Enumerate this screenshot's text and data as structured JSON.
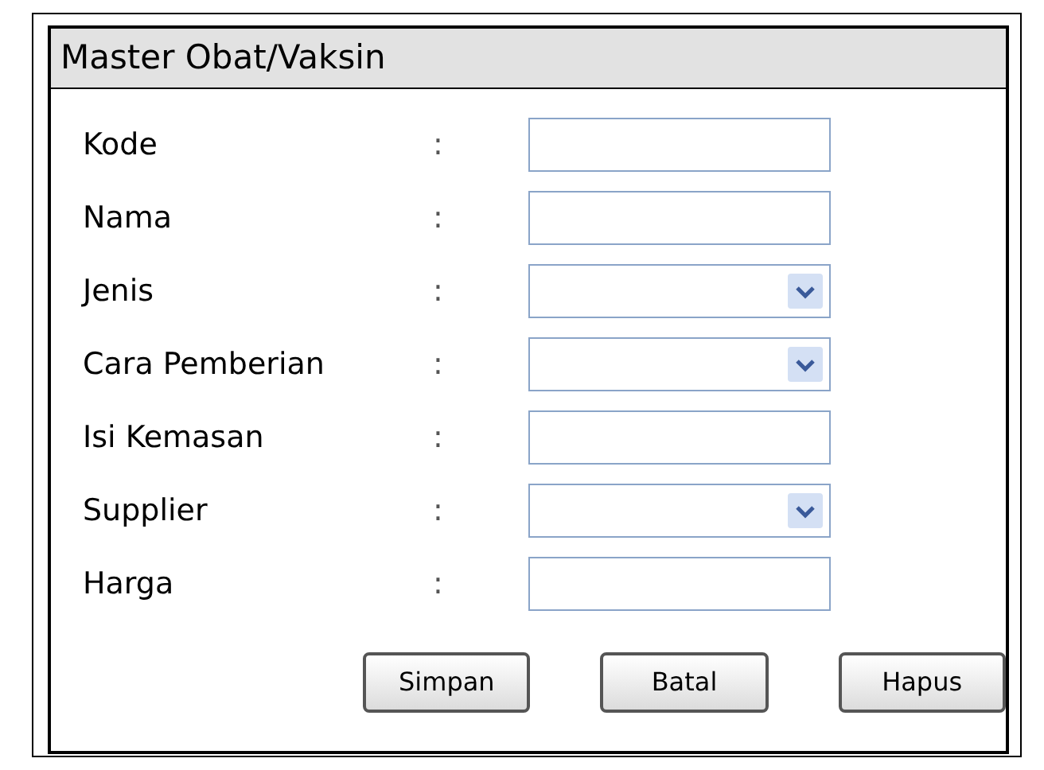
{
  "window": {
    "title": "Master Obat/Vaksin"
  },
  "fields": [
    {
      "label": "Kode",
      "separator": ":",
      "kind": "text"
    },
    {
      "label": "Nama",
      "separator": ":",
      "kind": "text"
    },
    {
      "label": "Jenis",
      "separator": ":",
      "kind": "dropdown"
    },
    {
      "label": "Cara Pemberian",
      "separator": ":",
      "kind": "dropdown"
    },
    {
      "label": "Isi Kemasan",
      "separator": ":",
      "kind": "text"
    },
    {
      "label": "Supplier",
      "separator": ":",
      "kind": "dropdown"
    },
    {
      "label": "Harga",
      "separator": ":",
      "kind": "text"
    }
  ],
  "buttons": [
    "Simpan",
    "Batal",
    "Hapus"
  ]
}
